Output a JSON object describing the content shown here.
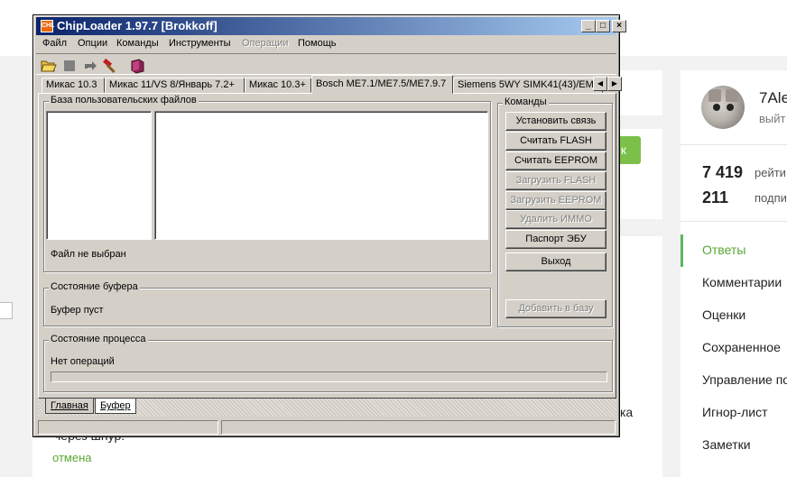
{
  "background": {
    "profile": {
      "name": "7Ale",
      "subtitle": "выйт"
    },
    "stats": [
      {
        "value": "7 419",
        "label": "рейти"
      },
      {
        "value": "211",
        "label": "подпис"
      }
    ],
    "green_button_label": "к",
    "side_menu": [
      "Ответы",
      "Комментарии",
      "Оценки",
      "Сохраненное",
      "Управление по",
      "Игнор-лист",
      "Заметки"
    ],
    "body_fragment_1": "ка",
    "body_fragment_2": "через шнур.",
    "cancel_link": "отмена",
    "colors": {
      "accent": "#5aa832",
      "button_green": "#7cc04a"
    }
  },
  "window": {
    "title": "ChipLoader 1.97.7 [Brokkoff]",
    "icon_text": "CHL",
    "controls": [
      "_",
      "□",
      "×"
    ],
    "menu": [
      {
        "label": "Файл",
        "enabled": true
      },
      {
        "label": "Опции",
        "enabled": true
      },
      {
        "label": "Команды",
        "enabled": true
      },
      {
        "label": "Инструменты",
        "enabled": true
      },
      {
        "label": "Операции",
        "enabled": false
      },
      {
        "label": "Помощь",
        "enabled": true
      }
    ],
    "toolbar": [
      "open-folder-icon",
      "stop-icon",
      "reload-icon",
      "hammer-icon",
      "book-icon"
    ],
    "tabs": [
      "Микас 10.3",
      "Микас 11/VS 8/Январь 7.2+",
      "Микас 10.3+",
      "Bosch ME7.1/ME7.5/ME7.9.7",
      "Siemens 5WY SIMK41(43)/EM"
    ],
    "active_tab": 3,
    "user_db": {
      "title": "База пользовательских файлов",
      "file_status": "Файл не выбран"
    },
    "buffer": {
      "title": "Состояние буфера",
      "status": "Буфер пуст"
    },
    "process": {
      "title": "Состояние процесса",
      "status": "Нет операций",
      "progress": 0
    },
    "commands": {
      "title": "Команды",
      "buttons": [
        {
          "label": "Установить связь",
          "enabled": true
        },
        {
          "label": "Считать FLASH",
          "enabled": true
        },
        {
          "label": "Считать EEPROM",
          "enabled": true
        },
        {
          "label": "Загрузить FLASH",
          "enabled": false
        },
        {
          "label": "Загрузить EEPROM",
          "enabled": false
        },
        {
          "label": "Удалить ИММО",
          "enabled": false
        },
        {
          "label": "Паспорт ЭБУ",
          "enabled": true
        },
        {
          "label": "Выход",
          "enabled": true
        }
      ],
      "add_to_db": {
        "label": "Добавить в базу",
        "enabled": false
      }
    },
    "bottom_tabs": [
      "Главная",
      "Буфер"
    ]
  }
}
